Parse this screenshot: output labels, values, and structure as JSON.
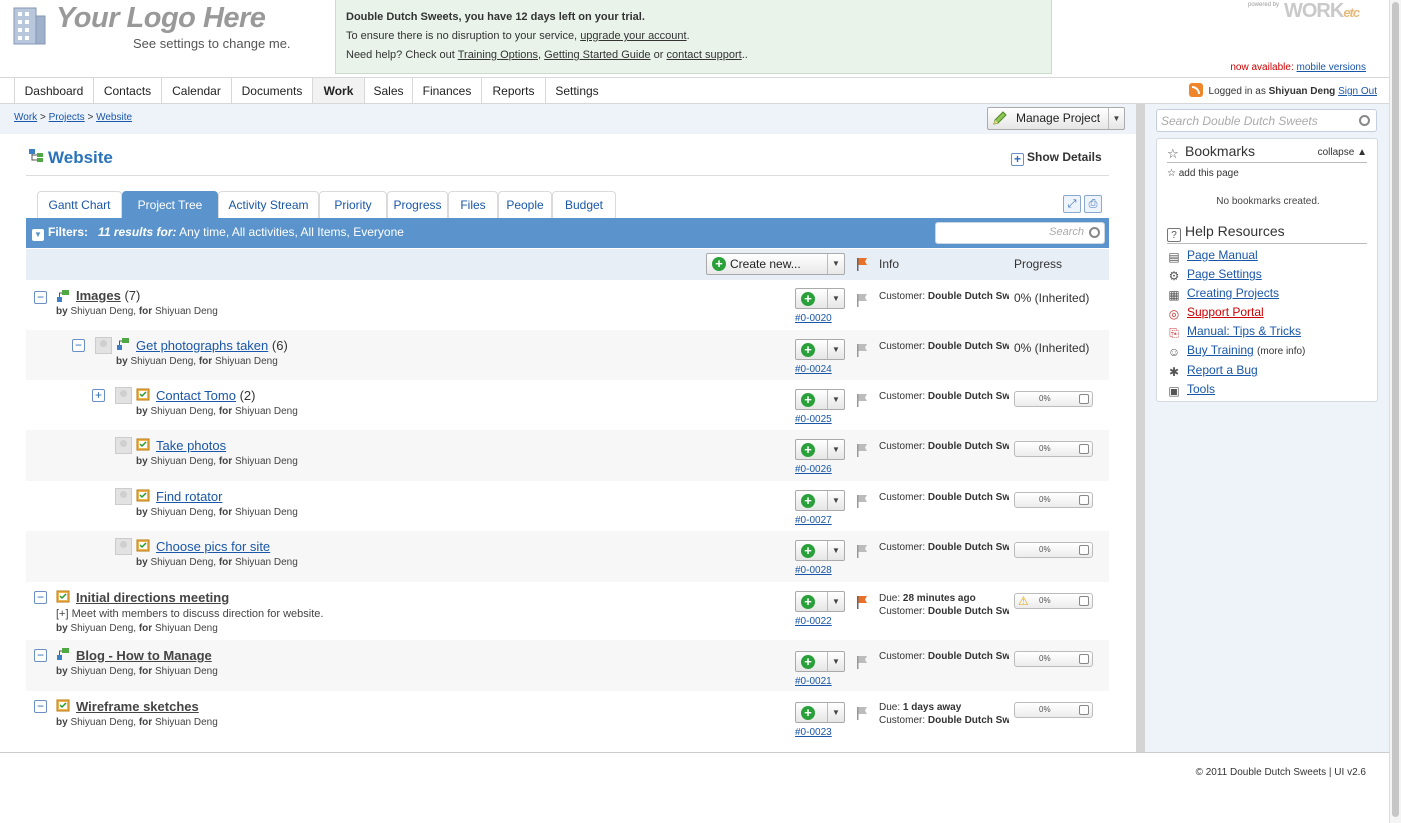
{
  "header": {
    "logo_title": "Your Logo Here",
    "logo_sub": "See settings to change me.",
    "trial": {
      "line1": "Double Dutch Sweets, you have 12 days left on your trial.",
      "line2_pre": "To ensure there is no disruption to your service, ",
      "line2_link": "upgrade your account",
      "line2_post": ".",
      "line3_pre": "Need help? Check out ",
      "link_training": "Training Options",
      "comma": ", ",
      "link_guide": "Getting Started Guide",
      "or": " or ",
      "link_support": "contact support",
      "line3_post": ".."
    },
    "powered_by": "powered by",
    "brand": "WORK",
    "brand_suffix": "etc",
    "now_available": "now available:",
    "mobile_link": "mobile versions"
  },
  "nav": {
    "tabs": [
      "Dashboard",
      "Contacts",
      "Calendar",
      "Documents",
      "Work",
      "Sales",
      "Finances",
      "Reports",
      "Settings"
    ],
    "active": "Work",
    "logged_in_pre": "Logged in as",
    "user": "Shiyuan Deng",
    "sign_out": "Sign Out"
  },
  "breadcrumb": {
    "items": [
      "Work",
      "Projects",
      "Website"
    ],
    "sep": ">"
  },
  "manage_label": "Manage Project",
  "page_title": "Website",
  "show_details": "Show Details",
  "project_tabs": [
    "Gantt Chart",
    "Project Tree",
    "Activity Stream",
    "Priority",
    "Progress",
    "Files",
    "People",
    "Budget"
  ],
  "active_tab": "Project Tree",
  "filters": {
    "label": "Filters:",
    "results": "11 results for:",
    "criteria": "Any time, All activities, All Items, Everyone",
    "search_placeholder": "Search"
  },
  "columns": {
    "create_new": "Create new...",
    "info": "Info",
    "progress": "Progress"
  },
  "rows": [
    {
      "title": "Images",
      "count": "(7)",
      "by": "Shiyuan Deng",
      "for": "Shiyuan Deng",
      "id": "#0-0020",
      "customer": "Double Dutch Sw",
      "progress": "0% (Inherited)"
    },
    {
      "title": "Get photographs taken",
      "count": "(6)",
      "by": "Shiyuan Deng",
      "for": "Shiyuan Deng",
      "id": "#0-0024",
      "customer": "Double Dutch Sw",
      "progress": "0% (Inherited)"
    },
    {
      "title": "Contact Tomo",
      "count": "(2)",
      "by": "Shiyuan Deng",
      "for": "Shiyuan Deng",
      "id": "#0-0025",
      "customer": "Double Dutch Sw",
      "progress": "0%"
    },
    {
      "title": "Take photos",
      "count": "",
      "by": "Shiyuan Deng",
      "for": "Shiyuan Deng",
      "id": "#0-0026",
      "customer": "Double Dutch Sw",
      "progress": "0%"
    },
    {
      "title": "Find rotator",
      "count": "",
      "by": "Shiyuan Deng",
      "for": "Shiyuan Deng",
      "id": "#0-0027",
      "customer": "Double Dutch Sw",
      "progress": "0%"
    },
    {
      "title": "Choose pics for site",
      "count": "",
      "by": "Shiyuan Deng",
      "for": "Shiyuan Deng",
      "id": "#0-0028",
      "customer": "Double Dutch Sw",
      "progress": "0%"
    },
    {
      "title": "Initial directions meeting",
      "count": "",
      "desc": "[+] Meet with members to discuss direction for website.",
      "by": "Shiyuan Deng",
      "for": "Shiyuan Deng",
      "id": "#0-0022",
      "due": "28 minutes ago",
      "customer": "Double Dutch Sw",
      "progress": "0%"
    },
    {
      "title": "Blog - How to Manage",
      "count": "",
      "by": "Shiyuan Deng",
      "for": "Shiyuan Deng",
      "id": "#0-0021",
      "customer": "Double Dutch Sw",
      "progress": "0%"
    },
    {
      "title": "Wireframe sketches",
      "count": "",
      "by": "Shiyuan Deng",
      "for": "Shiyuan Deng",
      "id": "#0-0023",
      "due": "1 days away",
      "customer": "Double Dutch Sw",
      "progress": "0%"
    }
  ],
  "labels": {
    "by": "by",
    "for": "for",
    "customer": "Customer:",
    "due": "Due:"
  },
  "sidebar": {
    "search_placeholder": "Search Double Dutch Sweets",
    "bookmarks_title": "Bookmarks",
    "collapse": "collapse",
    "add_page": "add this page",
    "no_bookmarks": "No bookmarks created.",
    "help_title": "Help Resources",
    "help_links": [
      "Page Manual",
      "Page Settings",
      "Creating Projects",
      "Support Portal",
      "Manual: Tips & Tricks",
      "Buy Training",
      "Report a Bug",
      "Tools"
    ],
    "more_info": "(more info)"
  },
  "footer": "© 2011 Double Dutch Sweets | UI v2.6",
  "colors": {
    "accent": "#5b94cc",
    "link": "#1a57a8",
    "flag_active": "#e8702a",
    "add_green": "#2aa03a"
  }
}
